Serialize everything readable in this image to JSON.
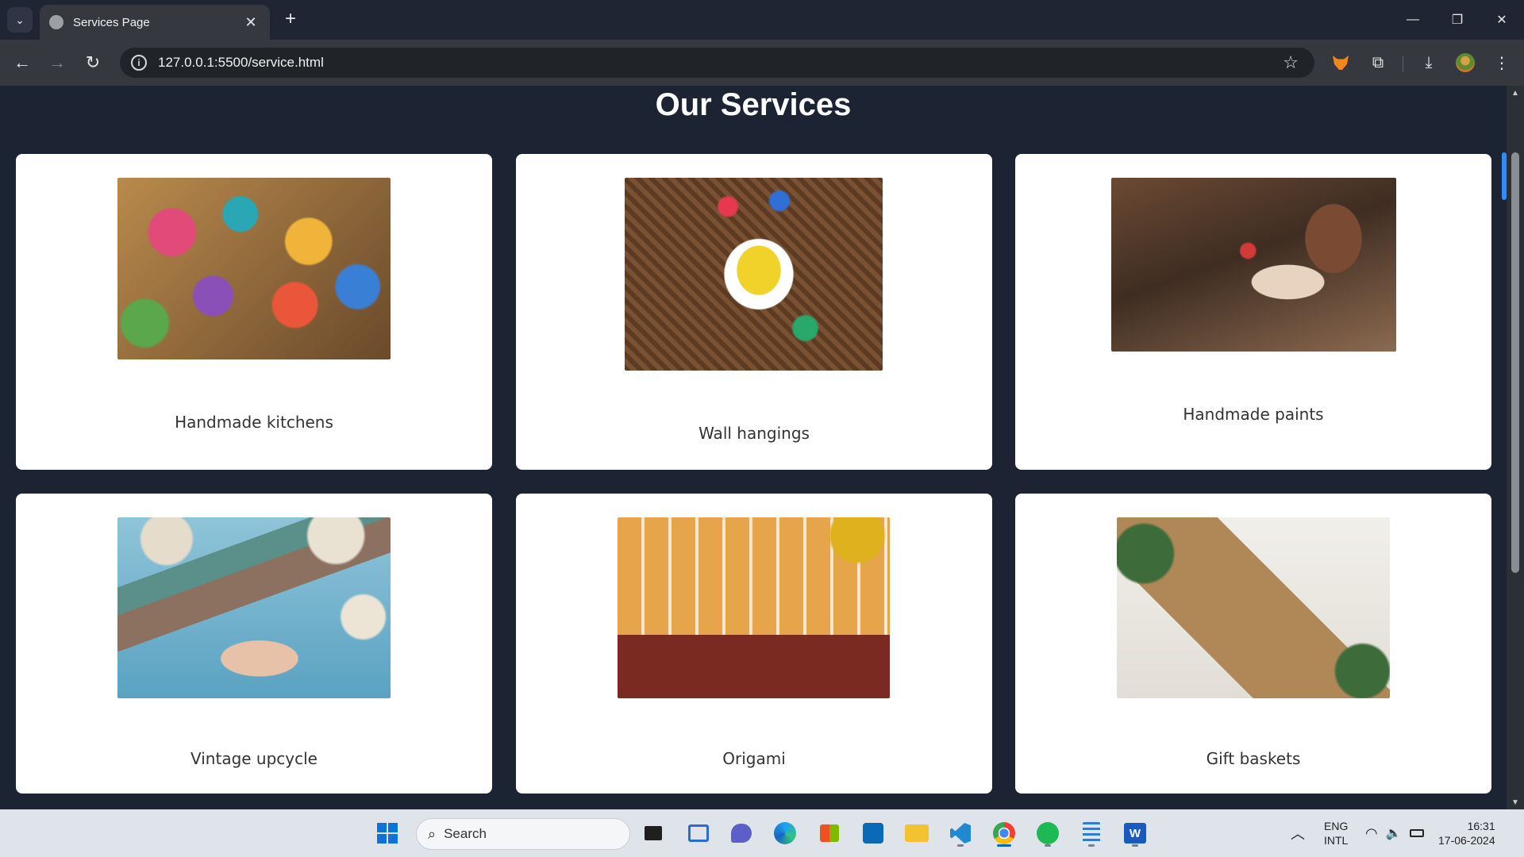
{
  "browser": {
    "tab_title": "Services Page",
    "tab_close": "✕",
    "new_tab": "+",
    "url": "127.0.0.1:5500/service.html",
    "controls": {
      "minimize": "—",
      "restore": "❐",
      "close": "✕"
    }
  },
  "page": {
    "title": "Our Services",
    "services": [
      {
        "label": "Handmade kitchens",
        "image": "painted-cookies-in-basket"
      },
      {
        "label": "Wall hangings",
        "image": "durga-face-wall-hanging"
      },
      {
        "label": "Handmade paints",
        "image": "person-painting-wooden-craft"
      },
      {
        "label": "Vintage upcycle",
        "image": "hands-weaving-yarn"
      },
      {
        "label": "Origami",
        "image": "craft-display-shelf"
      },
      {
        "label": "Gift baskets",
        "image": "gift-box-with-ornaments"
      }
    ]
  },
  "taskbar": {
    "search_label": "Search",
    "apps": [
      "start-icon",
      "task-view-icon",
      "widgets-icon",
      "chat-icon",
      "edge-icon",
      "store-icon",
      "app-icon",
      "file-explorer-icon",
      "vscode-icon",
      "chrome-icon",
      "spotify-icon",
      "notepad-icon",
      "word-icon"
    ],
    "lang_top": "ENG",
    "lang_bottom": "INTL",
    "time": "16:31",
    "date": "17-06-2024"
  }
}
